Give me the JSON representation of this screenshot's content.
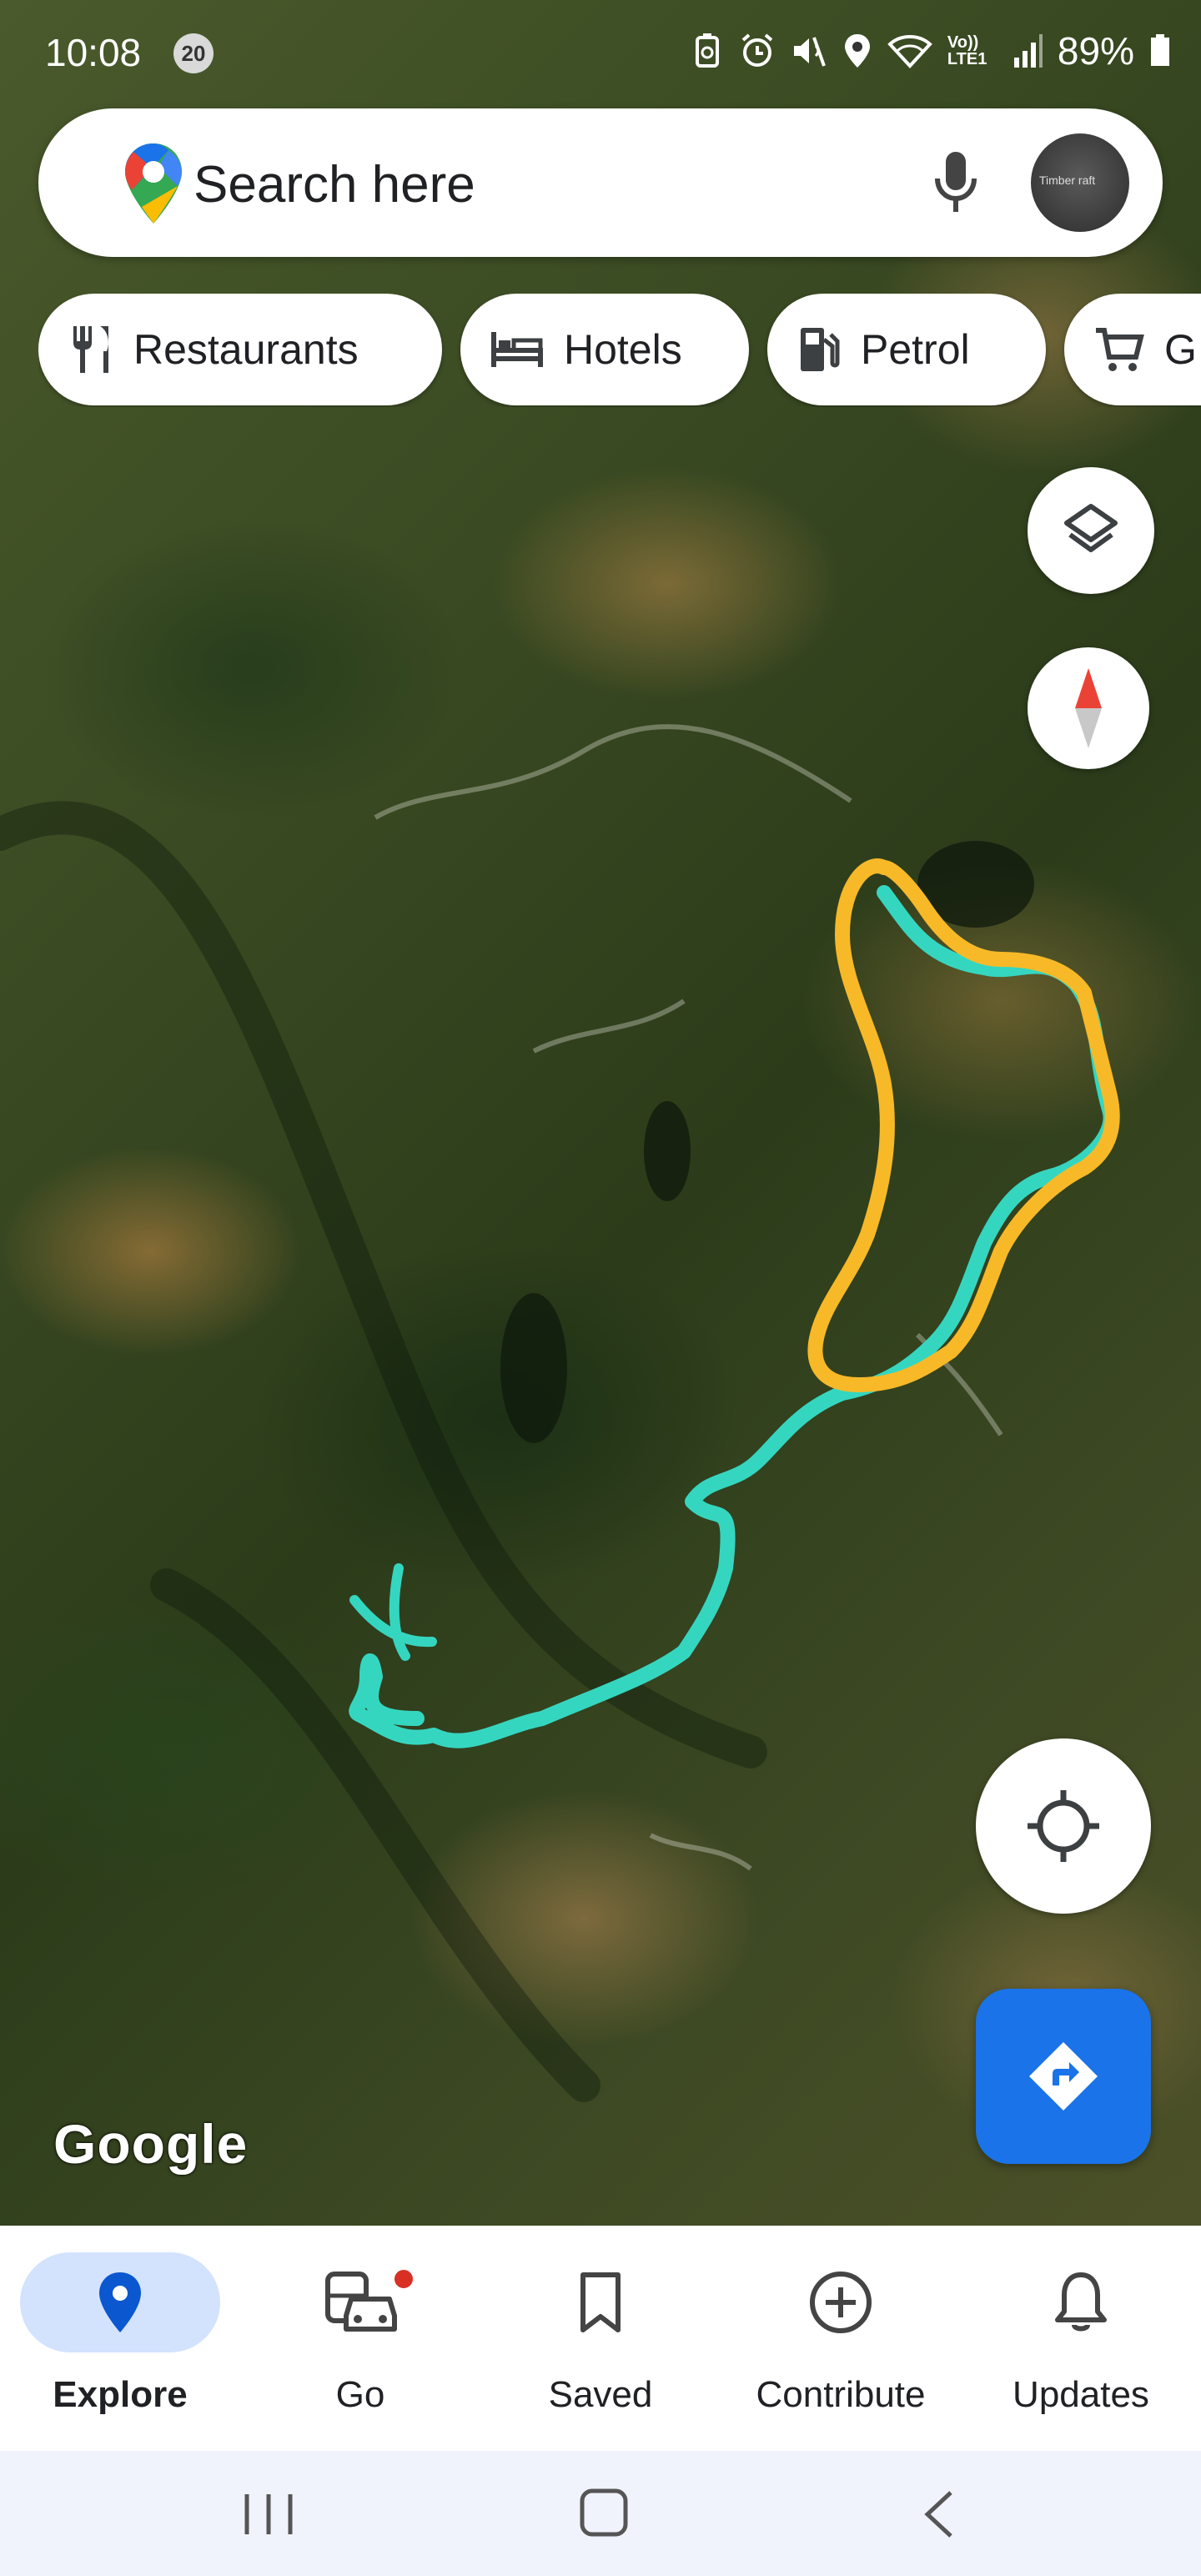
{
  "status_bar": {
    "time": "10:08",
    "notification_count": "20",
    "battery_percent": "89%",
    "icons": [
      "battery-saver-icon",
      "alarm-icon",
      "mute-icon",
      "location-icon",
      "wifi-icon",
      "volte-icon",
      "signal-icon",
      "battery-icon"
    ],
    "volte_label": "Vo)) LTE1"
  },
  "search": {
    "placeholder": "Search here",
    "avatar_text": "Timber raft"
  },
  "chips": [
    {
      "label": "Restaurants",
      "icon": "fork-knife-icon"
    },
    {
      "label": "Hotels",
      "icon": "bed-icon"
    },
    {
      "label": "Petrol",
      "icon": "fuel-pump-icon"
    },
    {
      "label": "G",
      "icon": "cart-icon"
    }
  ],
  "map": {
    "attribution": "Google",
    "layer": "satellite",
    "route_colors": {
      "yellow": "#f7b928",
      "teal": "#35d6c0"
    }
  },
  "controls": {
    "layers_icon": "layers-icon",
    "compass_icon": "compass-icon",
    "my_location_icon": "my-location-icon",
    "directions_icon": "directions-icon"
  },
  "bottom_nav": [
    {
      "label": "Explore",
      "icon": "location-pin-icon",
      "active": true
    },
    {
      "label": "Go",
      "icon": "car-bus-icon",
      "active": false
    },
    {
      "label": "Saved",
      "icon": "bookmark-icon",
      "active": false
    },
    {
      "label": "Contribute",
      "icon": "add-circle-icon",
      "active": false
    },
    {
      "label": "Updates",
      "icon": "bell-icon",
      "active": false
    }
  ],
  "colors": {
    "accent": "#1a73e8",
    "active_tab_bg": "#d3e3fd",
    "notification_dot": "#d93025"
  }
}
